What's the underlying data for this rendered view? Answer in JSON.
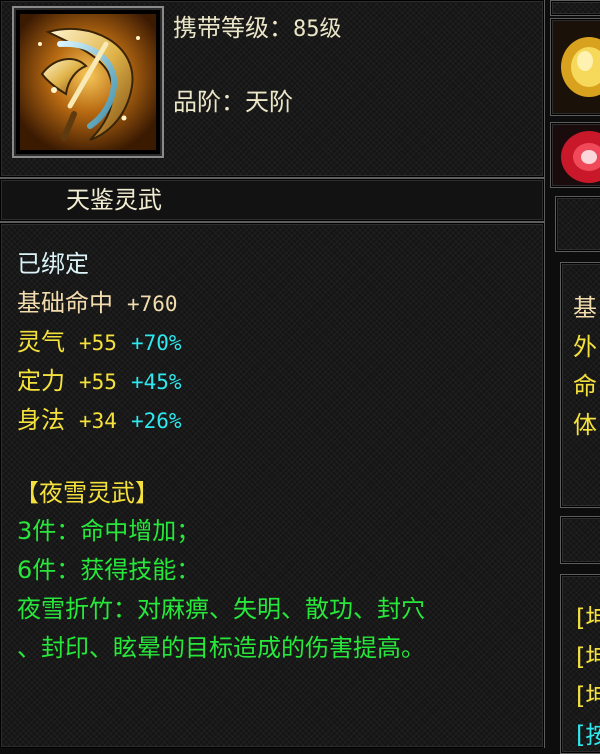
{
  "item": {
    "carry_level_label": "携带等级：",
    "carry_level_value": "85级",
    "grade_label": "品阶：",
    "grade_value": "天阶",
    "name": "天鉴灵武",
    "icon": "golden-weapon-icon"
  },
  "attributes": {
    "bound": "已绑定",
    "base": {
      "label": "基础命中",
      "value": "+760"
    },
    "stats": [
      {
        "label": "灵气",
        "value": "+55",
        "bonus": "+70%"
      },
      {
        "label": "定力",
        "value": "+55",
        "bonus": "+45%"
      },
      {
        "label": "身法",
        "value": "+34",
        "bonus": "+26%"
      }
    ]
  },
  "set": {
    "title": "【夜雪灵武】",
    "bonus_3": "3件：命中增加；",
    "bonus_6": "6件：获得技能：",
    "skill_line_1": "夜雪折竹：对麻痹、失明、散功、封穴",
    "skill_line_2": "、封印、眩晕的目标造成的伤害提高。"
  },
  "right_panel": {
    "partial_labels": [
      "基",
      "外",
      "命",
      "体"
    ],
    "partial_brackets": [
      "[坤",
      "[坤",
      "[坤",
      "[按"
    ]
  },
  "colors": {
    "white_text": "#dcf4f8",
    "beige_text": "#f2dcae",
    "yellow_text": "#f5e13c",
    "cyan_text": "#2ee8ee",
    "green_text": "#27e83a",
    "info_text": "#ece6c8"
  }
}
